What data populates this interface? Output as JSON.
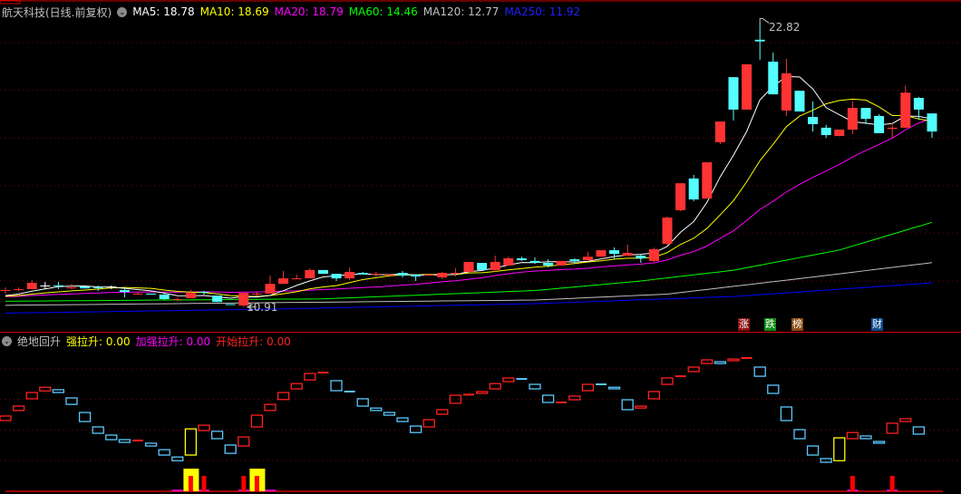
{
  "header": {
    "title": "航天科技(日线.前复权)",
    "ma5": "MA5: 18.78",
    "ma10": "MA10: 18.69",
    "ma20": "MA20: 18.79",
    "ma60": "MA60: 14.46",
    "ma120": "MA120: 12.77",
    "ma250": "MA250: 11.92"
  },
  "indicator_header": {
    "name": "绝地回升",
    "strong": "强拉升: 0.00",
    "boost": "加强拉升: 0.00",
    "start": "开始拉升: 0.00"
  },
  "annotations": {
    "high_label": "22.82",
    "low_label": "10.91",
    "tags": [
      {
        "text": "涨",
        "color": "#8b1010"
      },
      {
        "text": "跌",
        "color": "#108b10"
      },
      {
        "text": "榜",
        "color": "#8b4a10"
      },
      {
        "text": "财",
        "color": "#104a8b"
      }
    ]
  },
  "colors": {
    "up": "#ff3333",
    "down": "#54ffff",
    "flat": "#ffffff",
    "ma5": "#ffffff",
    "ma10": "#ffff00",
    "ma20": "#ff00ff",
    "ma60": "#00ff00",
    "ma120": "#c0c0c0",
    "ma250": "#0000ff",
    "grid": "#800000",
    "axis": "#d00000",
    "box_up": "#ff2020",
    "box_down": "#5ac8ff",
    "box_special": "#ffff00"
  },
  "chart_data": [
    {
      "type": "candlestick",
      "title": "航天科技(日线.前复权)",
      "ylim": [
        10.5,
        23
      ],
      "gridlines": [
        12,
        14,
        16,
        18,
        20,
        22
      ],
      "ohlc": [
        [
          11.6,
          11.73,
          11.47,
          11.62
        ],
        [
          11.64,
          11.73,
          11.58,
          11.66
        ],
        [
          11.66,
          12.04,
          11.66,
          11.92
        ],
        [
          11.81,
          11.96,
          11.66,
          11.81
        ],
        [
          11.82,
          11.96,
          11.66,
          11.8
        ],
        [
          11.72,
          11.88,
          11.66,
          11.73
        ],
        [
          11.77,
          11.77,
          11.69,
          11.69
        ],
        [
          11.74,
          11.81,
          11.58,
          11.73
        ],
        [
          11.77,
          11.81,
          11.66,
          11.77
        ],
        [
          11.62,
          11.69,
          11.31,
          11.54
        ],
        [
          11.46,
          11.54,
          11.43,
          11.47
        ],
        [
          11.47,
          11.47,
          11.43,
          11.43
        ],
        [
          11.43,
          11.5,
          11.2,
          11.24
        ],
        [
          11.23,
          11.31,
          11.17,
          11.24
        ],
        [
          11.28,
          11.62,
          11.28,
          11.5
        ],
        [
          11.55,
          11.58,
          11.43,
          11.54
        ],
        [
          11.39,
          11.39,
          11.12,
          11.12
        ],
        [
          11.03,
          11.03,
          11.01,
          11.01
        ],
        [
          10.97,
          11.5,
          10.91,
          11.5
        ],
        [
          11.45,
          11.54,
          11.39,
          11.47
        ],
        [
          11.47,
          12.23,
          11.47,
          11.88
        ],
        [
          11.88,
          12.42,
          11.88,
          12.11
        ],
        [
          12.09,
          12.27,
          12.09,
          12.11
        ],
        [
          12.11,
          12.53,
          12.11,
          12.46
        ],
        [
          12.46,
          12.46,
          12.3,
          12.3
        ],
        [
          12.3,
          12.3,
          12.0,
          12.11
        ],
        [
          12.11,
          12.57,
          12.04,
          12.38
        ],
        [
          12.34,
          12.38,
          12.27,
          12.27
        ],
        [
          12.28,
          12.38,
          12.19,
          12.3
        ],
        [
          12.26,
          12.3,
          12.23,
          12.27
        ],
        [
          12.34,
          12.42,
          12.15,
          12.23
        ],
        [
          12.27,
          12.27,
          12.0,
          12.19
        ],
        [
          12.26,
          12.3,
          12.23,
          12.27
        ],
        [
          12.15,
          12.38,
          12.08,
          12.34
        ],
        [
          12.33,
          12.53,
          12.19,
          12.34
        ],
        [
          12.38,
          12.8,
          12.38,
          12.8
        ],
        [
          12.76,
          12.76,
          12.46,
          12.46
        ],
        [
          12.46,
          13.06,
          12.38,
          12.8
        ],
        [
          12.65,
          13.02,
          12.65,
          12.95
        ],
        [
          12.95,
          13.02,
          12.84,
          12.87
        ],
        [
          12.84,
          12.99,
          12.72,
          12.76
        ],
        [
          12.76,
          12.91,
          12.57,
          12.65
        ],
        [
          12.65,
          12.84,
          12.65,
          12.84
        ],
        [
          12.91,
          12.95,
          12.72,
          12.84
        ],
        [
          12.87,
          13.22,
          12.87,
          13.02
        ],
        [
          13.02,
          13.29,
          13.02,
          13.29
        ],
        [
          13.29,
          13.41,
          12.91,
          13.14
        ],
        [
          13.06,
          13.52,
          13.06,
          13.18
        ],
        [
          13.06,
          13.1,
          12.76,
          12.95
        ],
        [
          12.84,
          13.4,
          12.8,
          13.33
        ],
        [
          13.56,
          14.7,
          13.5,
          14.66
        ],
        [
          14.97,
          16.1,
          14.93,
          16.1
        ],
        [
          16.3,
          16.45,
          15.35,
          15.42
        ],
        [
          15.46,
          16.98,
          15.46,
          16.98
        ],
        [
          17.82,
          18.69,
          17.74,
          18.69
        ],
        [
          20.55,
          20.55,
          18.73,
          19.19
        ],
        [
          19.19,
          21.09,
          19.19,
          21.09
        ],
        [
          22.12,
          22.82,
          21.28,
          22.05
        ],
        [
          21.2,
          21.58,
          19.83,
          19.83
        ],
        [
          19.15,
          21.32,
          18.92,
          20.71
        ],
        [
          19.98,
          19.98,
          19.11,
          19.11
        ],
        [
          18.88,
          19.53,
          18.27,
          18.58
        ],
        [
          18.43,
          18.55,
          18.0,
          18.12
        ],
        [
          18.08,
          18.35,
          18.08,
          18.35
        ],
        [
          18.35,
          19.53,
          18.16,
          19.26
        ],
        [
          19.26,
          19.26,
          18.58,
          18.8
        ],
        [
          18.92,
          19.0,
          18.2,
          18.2
        ],
        [
          18.38,
          18.62,
          18.0,
          18.43
        ],
        [
          18.43,
          20.2,
          18.43,
          19.9
        ],
        [
          19.68,
          19.72,
          18.77,
          19.19
        ],
        [
          19.03,
          19.03,
          18.0,
          18.27
        ]
      ],
      "ma_periods": [
        5,
        10,
        20
      ],
      "long_ma_anchors": {
        "ma60": [
          [
            0,
            11.15
          ],
          [
            24,
            11.25
          ],
          [
            40,
            11.6
          ],
          [
            48,
            12.0
          ],
          [
            55,
            12.45
          ],
          [
            63,
            13.3
          ],
          [
            70,
            14.46
          ]
        ],
        "ma120": [
          [
            0,
            10.98
          ],
          [
            40,
            11.2
          ],
          [
            50,
            11.45
          ],
          [
            60,
            12.1
          ],
          [
            70,
            12.77
          ]
        ],
        "ma250": [
          [
            0,
            10.65
          ],
          [
            20,
            10.82
          ],
          [
            40,
            11.05
          ],
          [
            55,
            11.35
          ],
          [
            70,
            11.92
          ]
        ]
      },
      "high": {
        "index": 57,
        "value": 22.82
      },
      "low": {
        "index": 18,
        "value": 10.91
      }
    },
    {
      "type": "box-indicator",
      "title": "绝地回升",
      "ylim": [
        0,
        110
      ],
      "gridlines": [
        25,
        50,
        75,
        100
      ],
      "boxes": [
        [
          57.8,
          61.5,
          "u"
        ],
        [
          66,
          69.6,
          "u"
        ],
        [
          75.6,
          80.7,
          "u"
        ],
        [
          82,
          85,
          "u"
        ],
        [
          83,
          80.7,
          "d"
        ],
        [
          76.3,
          71,
          "d"
        ],
        [
          64.4,
          57,
          "d"
        ],
        [
          52.6,
          47.4,
          "d"
        ],
        [
          45.9,
          42.2,
          "d"
        ],
        [
          42.2,
          40,
          "d"
        ],
        [
          41.5,
          41.5,
          "u"
        ],
        [
          39.3,
          37,
          "d"
        ],
        [
          34,
          29.6,
          "d"
        ],
        [
          28,
          25,
          "d"
        ],
        [
          29.6,
          51,
          "s"
        ],
        [
          49.6,
          54,
          "u"
        ],
        [
          49,
          43,
          "d"
        ],
        [
          37.8,
          31,
          "d"
        ],
        [
          37,
          44.4,
          "u"
        ],
        [
          52.6,
          62.2,
          "u"
        ],
        [
          66,
          71,
          "u"
        ],
        [
          75,
          80.7,
          "u"
        ],
        [
          83.7,
          88,
          "u"
        ],
        [
          91,
          96.3,
          "u"
        ],
        [
          97,
          97,
          "u"
        ],
        [
          90.4,
          82.2,
          "d"
        ],
        [
          81.5,
          81.5,
          "d"
        ],
        [
          75.6,
          69.6,
          "d"
        ],
        [
          68,
          66,
          "d"
        ],
        [
          64.4,
          62.2,
          "d"
        ],
        [
          60,
          57,
          "d"
        ],
        [
          53.3,
          48,
          "d"
        ],
        [
          52.6,
          58.5,
          "u"
        ],
        [
          63,
          66.7,
          "u"
        ],
        [
          71.9,
          78.5,
          "u"
        ],
        [
          79,
          79,
          "u"
        ],
        [
          80,
          81.5,
          "u"
        ],
        [
          83.7,
          88,
          "u"
        ],
        [
          89.6,
          92.6,
          "u"
        ],
        [
          91.8,
          91.8,
          "d"
        ],
        [
          87.4,
          83.7,
          "d"
        ],
        [
          78.5,
          72.6,
          "d"
        ],
        [
          72.6,
          72.6,
          "u"
        ],
        [
          74.8,
          77.8,
          "u"
        ],
        [
          82.2,
          87.4,
          "u"
        ],
        [
          87.4,
          87.4,
          "d"
        ],
        [
          85,
          83.7,
          "d"
        ],
        [
          74.8,
          66.7,
          "d"
        ],
        [
          68,
          69.6,
          "u"
        ],
        [
          75.6,
          81.5,
          "u"
        ],
        [
          87.4,
          92.6,
          "u"
        ],
        [
          94,
          94,
          "u"
        ],
        [
          97.8,
          101.5,
          "u"
        ],
        [
          104.4,
          107.4,
          "u"
        ],
        [
          105.9,
          104.4,
          "d"
        ],
        [
          106.7,
          108.1,
          "u"
        ],
        [
          108.9,
          108.9,
          "u"
        ],
        [
          101.5,
          94,
          "d"
        ],
        [
          86.7,
          80,
          "d"
        ],
        [
          68.9,
          57.8,
          "d"
        ],
        [
          50.4,
          43,
          "d"
        ],
        [
          37,
          29.6,
          "d"
        ],
        [
          26.7,
          23.7,
          "d"
        ],
        [
          25,
          43.7,
          "s"
        ],
        [
          43,
          48,
          "u"
        ],
        [
          45.2,
          43,
          "d"
        ],
        [
          40.7,
          39.3,
          "d"
        ],
        [
          47.4,
          55.6,
          "u"
        ],
        [
          57,
          59.3,
          "u"
        ],
        [
          52.6,
          46.7,
          "d"
        ]
      ],
      "strong_bars": [
        [
          14,
          18.5
        ],
        [
          19,
          18.5
        ]
      ],
      "start_bars": [
        [
          14,
          12.6
        ],
        [
          15,
          12.6
        ],
        [
          18,
          12.6
        ],
        [
          19,
          12.6
        ],
        [
          64,
          12.6
        ],
        [
          67,
          12.6
        ]
      ],
      "boost_marks": [
        13,
        14,
        15,
        18,
        19,
        20,
        64,
        67
      ]
    }
  ]
}
